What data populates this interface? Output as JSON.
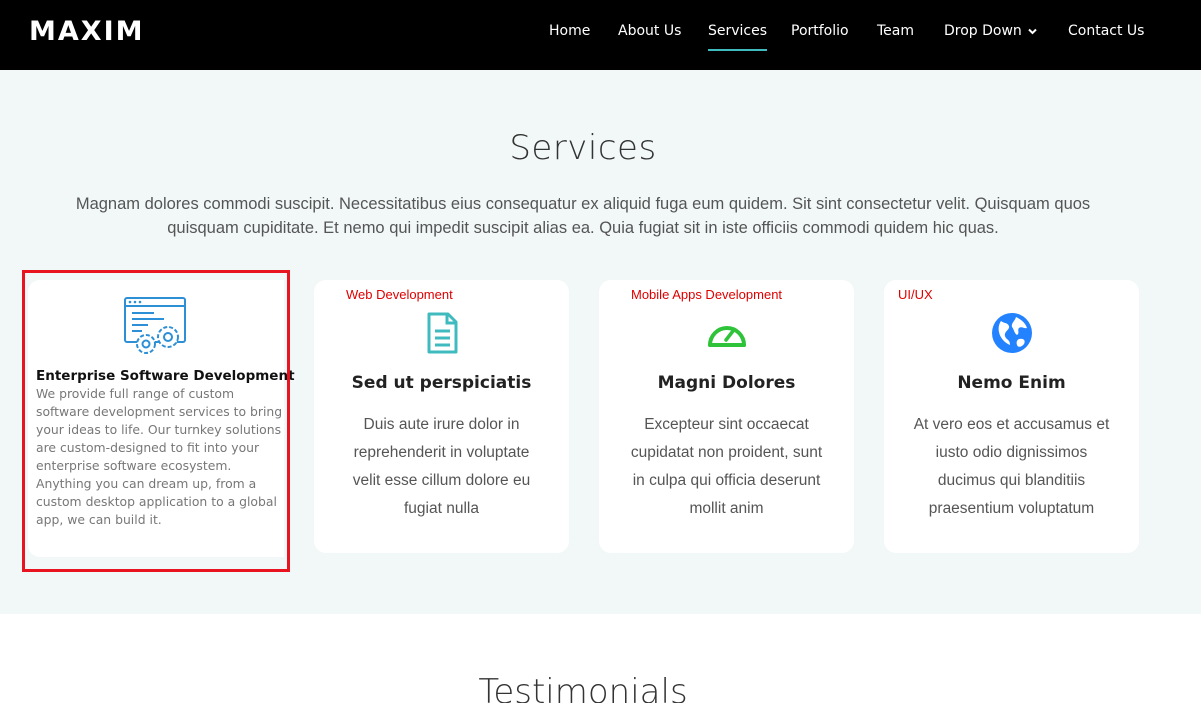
{
  "header": {
    "logo": "MAXIM",
    "nav": [
      {
        "label": "Home"
      },
      {
        "label": "About Us"
      },
      {
        "label": "Services"
      },
      {
        "label": "Portfolio"
      },
      {
        "label": "Team"
      },
      {
        "label": "Drop Down"
      },
      {
        "label": "Contact Us"
      }
    ],
    "active_item": "Services",
    "accent_color": "#3fbbc0"
  },
  "services": {
    "title": "Services",
    "intro": "Magnam dolores commodi suscipit. Necessitatibus eius consequatur ex aliquid fuga eum quidem. Sit sint consectetur velit. Quisquam quos quisquam cupiditate. Et nemo qui impedit suscipit alias ea. Quia fugiat sit in iste officiis commodi quidem hic quas.",
    "highlighted_card": {
      "title": "Enterprise Software Development",
      "description": "We provide full range of custom software development services to bring your ideas to life. Our turnkey solutions are custom-designed to fit into your enterprise software ecosystem. Anything you can dream up, from a custom desktop application to a global app, we can build it.",
      "icon": "software-gears-icon",
      "highlight_color": "#e8141f"
    },
    "cards": [
      {
        "category": "Web Development",
        "title": "Sed ut perspiciatis",
        "description": "Duis aute irure dolor in reprehenderit in voluptate velit esse cillum dolore eu fugiat nulla",
        "icon": "document-icon",
        "icon_color": "#3fbbc0"
      },
      {
        "category": "Mobile Apps Development",
        "title": "Magni Dolores",
        "description": "Excepteur sint occaecat cupidatat non proident, sunt in culpa qui officia deserunt mollit anim",
        "icon": "speedometer-icon",
        "icon_color": "#2fc33a"
      },
      {
        "category": "UI/UX",
        "title": "Nemo Enim",
        "description": "At vero eos et accusamus et iusto odio dignissimos ducimus qui blanditiis praesentium voluptatum",
        "icon": "globe-icon",
        "icon_color": "#2282ff"
      }
    ],
    "category_color": "#e00000"
  },
  "testimonials": {
    "title": "Testimonials"
  }
}
